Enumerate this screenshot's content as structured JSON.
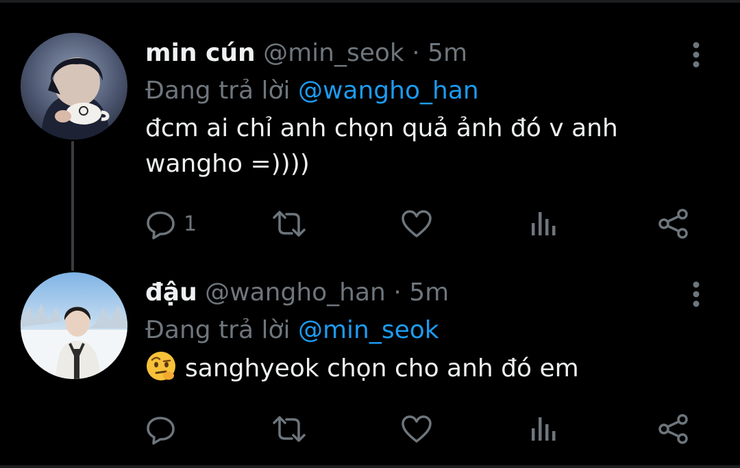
{
  "tweets": [
    {
      "display_name": "min cún",
      "handle": "@min_seok",
      "separator": "·",
      "time": "5m",
      "reply_prefix": "Đang trả lời",
      "reply_to": "@wangho_han",
      "text": "đcm ai chỉ anh chọn quả ảnh đó v anh wangho =))))",
      "reply_count": "1",
      "avatar_icon": "avatar-photo"
    },
    {
      "display_name": "đậu",
      "handle": "@wangho_han",
      "separator": "·",
      "time": "5m",
      "reply_prefix": "Đang trả lời",
      "reply_to": "@min_seok",
      "emoji_icon": "face-with-raised-eyebrow-emoji",
      "text": "sanghyeok chọn cho anh đó em",
      "reply_count": "",
      "avatar_icon": "avatar-photo"
    }
  ],
  "colors": {
    "background": "#000000",
    "text_primary": "#eef0f1",
    "text_secondary": "#6e767d",
    "mention": "#1d9bf0",
    "icon": "#6e767d"
  },
  "icons": [
    "reply-icon",
    "retweet-icon",
    "like-icon",
    "views-icon",
    "share-icon",
    "more-options-icon"
  ]
}
